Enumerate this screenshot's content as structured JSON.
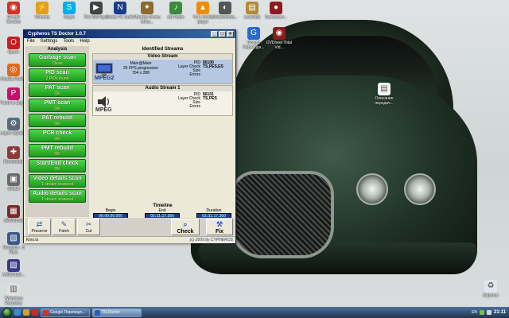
{
  "desktop": {
    "icons_top": [
      {
        "label": "Google Chrome",
        "name": "google-chrome-icon",
        "color": "#d93025",
        "glyph": "◉"
      },
      {
        "label": "Winamp",
        "name": "winamp-icon",
        "color": "#e0a020",
        "glyph": "⚡"
      },
      {
        "label": "Skype",
        "name": "skype-icon",
        "color": "#00aff0",
        "glyph": "S"
      },
      {
        "label": "The KMPlayer",
        "name": "kmplayer-icon",
        "color": "#444",
        "glyph": "▶"
      },
      {
        "label": "Nokia PC Suite",
        "name": "nokia-icon",
        "color": "#1a3c8c",
        "glyph": "N"
      },
      {
        "label": "Мастер Охоты Мега...",
        "name": "game-icon",
        "color": "#8c6a2c",
        "glyph": "✦"
      },
      {
        "label": "AB Radio",
        "name": "radio-icon",
        "color": "#3a8c3a",
        "glyph": "♪"
      },
      {
        "label": "VLC media player",
        "name": "vlc-icon",
        "color": "#f08c00",
        "glyph": "▲"
      },
      {
        "label": "MediaWorks...",
        "name": "media-icon",
        "color": "#555",
        "glyph": "◐"
      },
      {
        "label": "Loarel(3)",
        "name": "folder-icon",
        "color": "#b08c3a",
        "glyph": "▤"
      },
      {
        "label": "Samsonov...",
        "name": "samsonov-icon",
        "color": "#8c1c1c",
        "glyph": "●"
      }
    ],
    "icons_left": [
      {
        "label": "Opera",
        "name": "opera-icon",
        "color": "#cc1c1c",
        "glyph": "O"
      },
      {
        "label": "Mozilla Firefox",
        "name": "firefox-icon",
        "color": "#e06a1c",
        "glyph": "◎"
      },
      {
        "label": "Punto Is Skype",
        "name": "punto-icon",
        "color": "#c4126a",
        "glyph": "P"
      },
      {
        "label": "Logon Tajnebel",
        "name": "logon-icon",
        "color": "#5a6a7a",
        "glyph": "⚙"
      },
      {
        "label": "Remember",
        "name": "remember-icon",
        "color": "#8c3a3a",
        "glyph": "✚"
      },
      {
        "label": "default",
        "name": "default-icon",
        "color": "#6a6a6a",
        "glyph": "▣"
      },
      {
        "label": "xRWebmin",
        "name": "webmin-icon",
        "color": "#7a2a2a",
        "glyph": "▦"
      },
      {
        "label": "Template - 3 Rino",
        "name": "template-icon",
        "color": "#3a5a8c",
        "glyph": "▧"
      },
      {
        "label": "AddWebsit...",
        "name": "addweb-icon",
        "color": "#3a3a8c",
        "glyph": "▨"
      },
      {
        "label": "7Windows Recovery",
        "name": "recovery-icon",
        "color": "#e0e0e0",
        "glyph": "▥"
      }
    ],
    "icons_mid": [
      {
        "label": "Google Переводч...",
        "name": "google-translate-icon",
        "color": "#2a6ad0",
        "glyph": "G"
      },
      {
        "label": "DVDneet Total Vid...",
        "name": "dvd-icon",
        "color": "#8c1c1c",
        "glyph": "◉"
      }
    ],
    "icon_right_top": {
      "label": "Описание передач...",
      "name": "document-icon"
    },
    "icon_right_bottom": {
      "label": "Корзина",
      "name": "recycle-bin-icon"
    }
  },
  "app": {
    "title": "Cypheros TS Doctor 1.0.7",
    "menu": [
      "File",
      "Settings",
      "Tools",
      "Help"
    ],
    "analysis_header": "Analysis",
    "scans": [
      {
        "title": "Garbage scan",
        "status": "Clean"
      },
      {
        "title": "PID scan",
        "status": "2 PIDs found"
      },
      {
        "title": "PAT scan",
        "status": "OK"
      },
      {
        "title": "PMT scan",
        "status": "OK"
      },
      {
        "title": "PAT rebuild",
        "status": "OK"
      },
      {
        "title": "PCR check",
        "status": "OK"
      },
      {
        "title": "PMT rebuild",
        "status": "OK"
      },
      {
        "title": "Start/End check",
        "status": "OK"
      },
      {
        "title": "Video details scan",
        "status": "1 stream scanned"
      },
      {
        "title": "Audio details scan",
        "status": "1 stream scanned"
      }
    ],
    "streams_header": "Identified Streams",
    "video": {
      "header": "Video Stream",
      "codec": "MPEG2",
      "name": "Main@Main",
      "fps": "25 FPS progressive",
      "resolution": "704 x 288",
      "labels": [
        "PID",
        "Layer Check",
        "Size",
        "Errors"
      ],
      "pid": "$0100",
      "layer": "TS,PES,ES"
    },
    "audio": {
      "header": "Audio Stream 1",
      "codec": "MPEG",
      "labels": [
        "PID",
        "Layer Check",
        "Size",
        "Errors"
      ],
      "pid": "$0101",
      "layer": "TS,PES"
    },
    "timeline": {
      "header": "Timeline",
      "begin_label": "Begin",
      "begin": "00:00:00.000",
      "end_label": "End",
      "end": "02:31:17.360",
      "duration_label": "Duration",
      "duration": "02:31:17.360"
    },
    "tools": {
      "preserve": "Preserve",
      "patch": "Patch",
      "cut": "Cut",
      "check": "Check",
      "fix": "Fix"
    },
    "status_file": "Kino.ts",
    "status_copyright": "(c) 2009 by CYPHEROS"
  },
  "taskbar": {
    "tasks": [
      {
        "label": "Google Переводч...",
        "name": "task-google-translate",
        "active": false
      },
      {
        "label": "TS Doctor",
        "name": "task-ts-doctor",
        "active": true
      }
    ],
    "lang": "EN",
    "clock": "21:11"
  }
}
